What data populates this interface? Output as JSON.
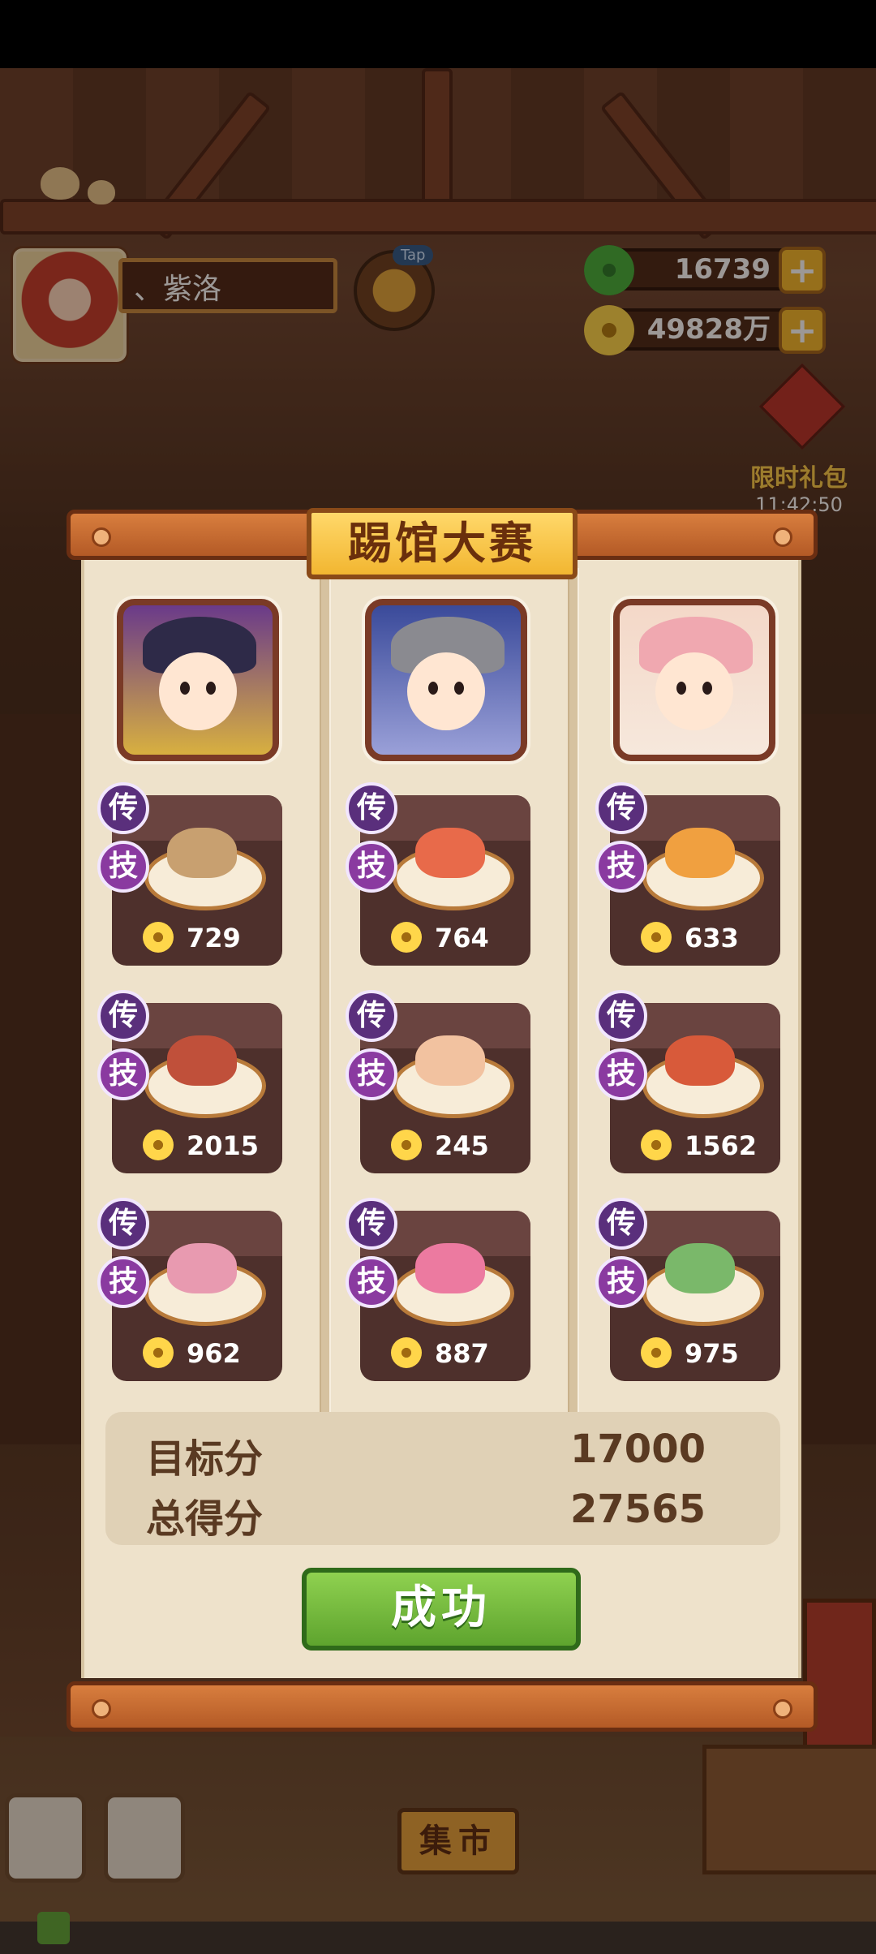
{
  "hud": {
    "player_name": "、紫洛",
    "tap_label": "Tap",
    "jade_amount": "16739",
    "coin_amount": "49828万",
    "plus_symbol": "+"
  },
  "gift": {
    "label": "限时礼包",
    "timer": "11:42:50"
  },
  "modal": {
    "title": "踢馆大赛",
    "badge_legend": "传",
    "badge_skill": "技",
    "columns": [
      {
        "chef": "chef-1",
        "dishes": [
          {
            "price": "729"
          },
          {
            "price": "2015"
          },
          {
            "price": "962"
          }
        ]
      },
      {
        "chef": "chef-2",
        "dishes": [
          {
            "price": "764"
          },
          {
            "price": "245"
          },
          {
            "price": "887"
          }
        ]
      },
      {
        "chef": "chef-3",
        "dishes": [
          {
            "price": "633"
          },
          {
            "price": "1562"
          },
          {
            "price": "975"
          }
        ]
      }
    ],
    "target_label": "目标分",
    "target_value": "17000",
    "total_label": "总得分",
    "total_value": "27565",
    "success_button": "成功"
  },
  "scene": {
    "market_sign": "集市"
  },
  "colors": {
    "title_gold": "#f2b631",
    "button_green": "#6cb536",
    "badge_purple": "#6c3a8a"
  }
}
